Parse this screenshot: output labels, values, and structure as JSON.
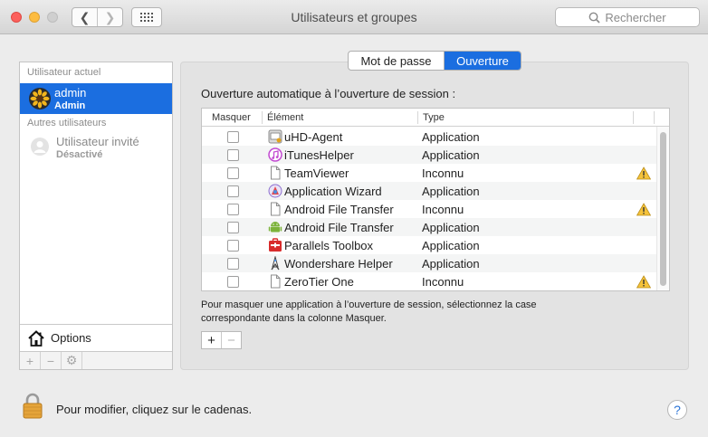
{
  "window": {
    "title": "Utilisateurs et groupes",
    "search_placeholder": "Rechercher"
  },
  "sidebar": {
    "current_section": "Utilisateur actuel",
    "current_user": {
      "name": "admin",
      "role": "Admin"
    },
    "other_section": "Autres utilisateurs",
    "guest_user": {
      "name": "Utilisateur invité",
      "status": "Désactivé"
    },
    "options_label": "Options",
    "tools": [
      "+",
      "−",
      "⚙"
    ]
  },
  "tabs": {
    "password": "Mot de passe",
    "login_items": "Ouverture",
    "active": "login_items"
  },
  "login_items": {
    "heading": "Ouverture automatique à l’ouverture de session :",
    "columns": {
      "hide": "Masquer",
      "item": "Élément",
      "kind": "Type"
    },
    "rows": [
      {
        "name": "uHD-Agent",
        "kind": "Application",
        "warning": false,
        "icon": "uhd-agent-icon"
      },
      {
        "name": "iTunesHelper",
        "kind": "Application",
        "warning": false,
        "icon": "itunes-icon"
      },
      {
        "name": "TeamViewer",
        "kind": "Inconnu",
        "warning": true,
        "icon": "blank-document-icon"
      },
      {
        "name": "Application Wizard",
        "kind": "Application",
        "warning": false,
        "icon": "wizard-icon"
      },
      {
        "name": "Android File Transfer",
        "kind": "Inconnu",
        "warning": true,
        "icon": "blank-document-icon"
      },
      {
        "name": "Android File Transfer",
        "kind": "Application",
        "warning": false,
        "icon": "android-icon"
      },
      {
        "name": "Parallels Toolbox",
        "kind": "Application",
        "warning": false,
        "icon": "parallels-icon"
      },
      {
        "name": "Wondershare Helper",
        "kind": "Application",
        "warning": false,
        "icon": "wondershare-icon"
      },
      {
        "name": "ZeroTier One",
        "kind": "Inconnu",
        "warning": true,
        "icon": "blank-document-icon"
      }
    ],
    "hint": "Pour masquer une application à l’ouverture de session, sélectionnez la case correspondante dans la colonne Masquer.",
    "add_label": "+",
    "remove_label": "−"
  },
  "footer": {
    "lock_text": "Pour modifier, cliquez sur le cadenas.",
    "help_label": "?"
  },
  "colors": {
    "accent": "#1b6ee0",
    "warning": "#f5c33b"
  }
}
